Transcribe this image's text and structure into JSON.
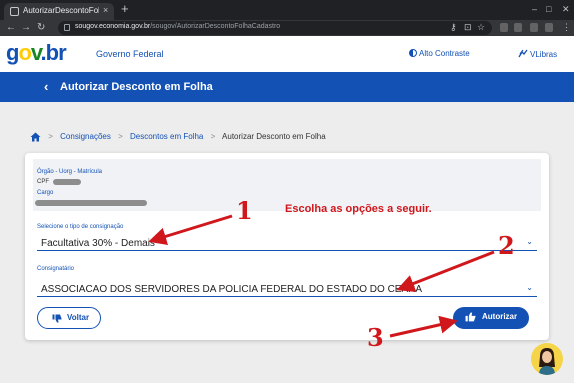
{
  "browser": {
    "tab_title": "AutorizarDescontoFolha",
    "tab_close": "×",
    "new_tab": "+",
    "url_host": "sougov.economia.gov.br",
    "url_path": "/sougov/AutorizarDescontoFolhaCadastro"
  },
  "header": {
    "logo_parts": [
      "g",
      "o",
      "v",
      ".",
      "b",
      "r"
    ],
    "title": "Governo Federal",
    "contrast_label": "Alto Contraste",
    "vlibras_label": "VLibras"
  },
  "title_bar": {
    "back": "‹",
    "title": "Autorizar Desconto em Folha"
  },
  "breadcrumb": {
    "items": [
      "Consignações",
      "Descontos em Folha",
      "Autorizar Desconto em Folha"
    ],
    "separator": ">"
  },
  "card": {
    "info": {
      "orgao_label": "Órgão - Uorg - Matrícula",
      "cpf_label": "CPF",
      "cargo_label": "Cargo"
    },
    "consignacao": {
      "label": "Selecione o tipo de consignação",
      "value": "Facultativa 30% - Demais"
    },
    "consignatario": {
      "label": "Consignatário",
      "value": "ASSOCIACAO DOS SERVIDORES DA POLICIA FEDERAL DO ESTADO DO CEARA"
    },
    "voltar_label": "Voltar",
    "autorizar_label": "Autorizar"
  },
  "annotations": {
    "instruction": "Escolha as opções a seguir.",
    "step1": "1",
    "step2": "2",
    "step3": "3",
    "color": "#d0181c"
  },
  "colors": {
    "primary": "#1351b4",
    "gov_yellow": "#ffcd07",
    "gov_green": "#168821"
  }
}
